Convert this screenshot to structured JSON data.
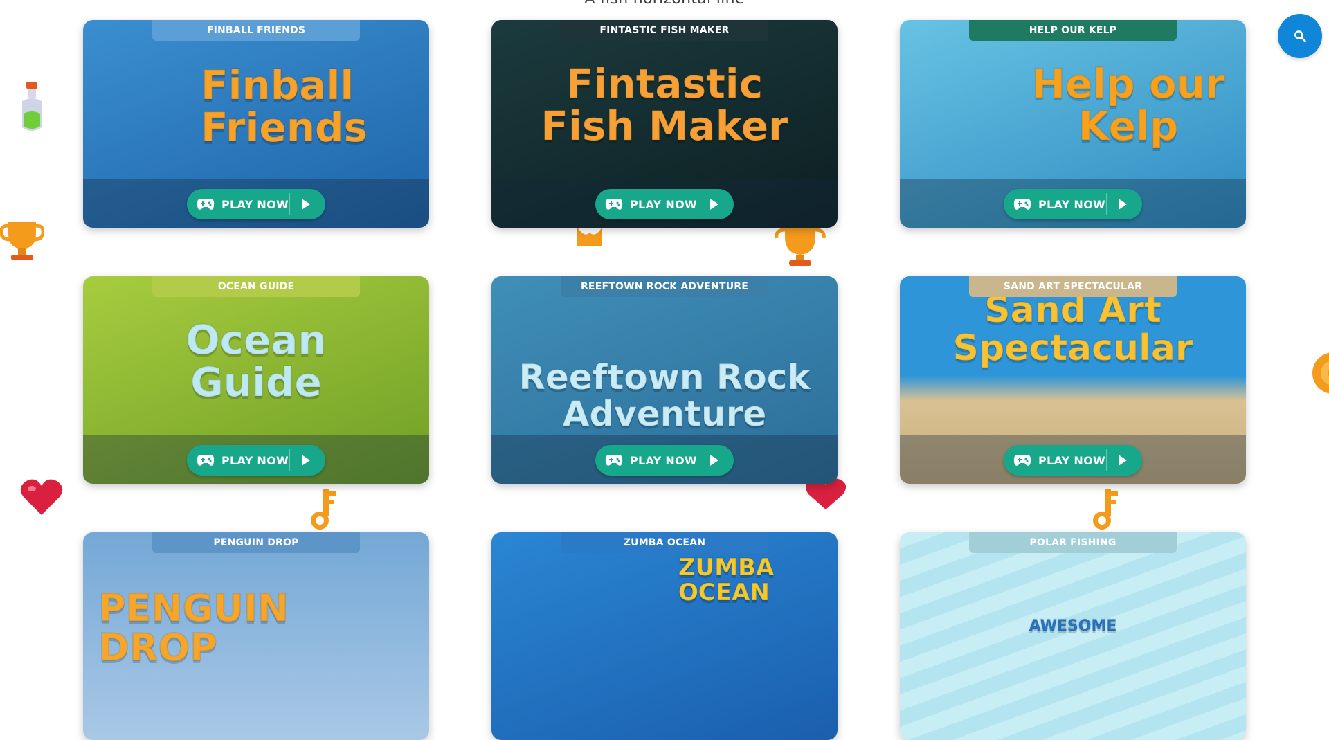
{
  "caption": "A fish horizontal line",
  "search": {
    "icon": "search-icon"
  },
  "play_label": "PLAY NOW",
  "cards": [
    {
      "tag": "FINBALL FRIENDS",
      "title": "Finball\nFriends",
      "bg": "#3a8fd0",
      "bg2": "#1e63a8",
      "tag_bg": "#5c9fd6",
      "title_color": "#f9a22a"
    },
    {
      "tag": "FINTASTIC FISH MAKER",
      "title": "Fintastic\nFish Maker",
      "bg": "#1b3b3e",
      "bg2": "#0d1f22",
      "tag_bg": "#1e3438",
      "title_color": "#f7a035"
    },
    {
      "tag": "HELP OUR KELP",
      "title": "Help our\nKelp",
      "bg": "#67c3e3",
      "bg2": "#2f8bc1",
      "tag_bg": "#1e7b62",
      "title_color": "#f7a11f"
    },
    {
      "tag": "OCEAN GUIDE",
      "title": "Ocean\nGuide",
      "bg": "#a7cc3f",
      "bg2": "#6f9f25",
      "tag_bg": "#b2cc4a",
      "title_color": "#bde9f3"
    },
    {
      "tag": "REEFTOWN ROCK ADVENTURE",
      "title": "Reeftown Rock\nAdventure",
      "bg": "#3f8fb8",
      "bg2": "#2b6d99",
      "tag_bg": "#3c7fa8",
      "title_color": "#c9ecf6"
    },
    {
      "tag": "SAND ART SPECTACULAR",
      "title": "Sand Art\nSpectacular",
      "bg": "#2e95d9",
      "bg2": "#d9c193",
      "tag_bg": "#c9b68c",
      "title_color": "#f8c233"
    },
    {
      "tag": "PENGUIN DROP",
      "title": "PENGUIN\nDROP",
      "bg": "#74a8d6",
      "bg2": "#a9c8e6",
      "tag_bg": "#5d95c9",
      "title_color": "#f5a62b"
    },
    {
      "tag": "ZUMBA OCEAN",
      "title": "ZUMBA\nOCEAN",
      "bg": "#2a86d3",
      "bg2": "#1a5fae",
      "tag_bg": "#2b7ac7",
      "title_color": "#f7c92b"
    },
    {
      "tag": "POLAR FISHING",
      "title": "AWESOME",
      "bg": "#c7eef5",
      "bg2": "#9fdcea",
      "tag_bg": "#a2cfd7",
      "title_color": "#2a74c6"
    }
  ]
}
